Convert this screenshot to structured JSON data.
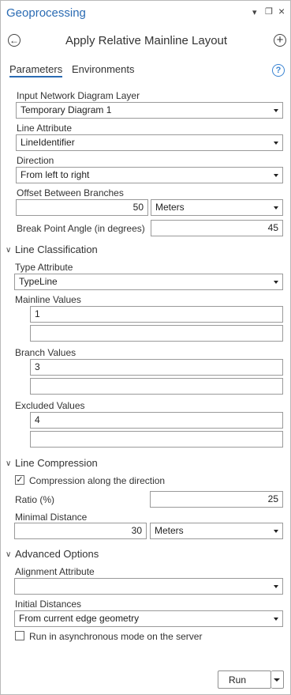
{
  "pane": {
    "title": "Geoprocessing",
    "controls": {
      "menu": "▾",
      "restore": "❐",
      "close": "×"
    }
  },
  "tool": {
    "title": "Apply Relative Mainline Layout",
    "back_icon": "arrow-left-icon",
    "add_icon": "plus-circle-icon"
  },
  "tabs": {
    "parameters": "Parameters",
    "environments": "Environments",
    "help": "?"
  },
  "params": {
    "input_layer": {
      "label": "Input Network Diagram Layer",
      "value": "Temporary Diagram 1"
    },
    "line_attribute": {
      "label": "Line Attribute",
      "value": "LineIdentifier"
    },
    "direction": {
      "label": "Direction",
      "value": "From left to right"
    },
    "offset": {
      "label": "Offset Between Branches",
      "value": "50",
      "unit": "Meters"
    },
    "break_angle": {
      "label": "Break Point Angle (in degrees)",
      "value": "45"
    }
  },
  "line_classification": {
    "title": "Line Classification",
    "type_attribute": {
      "label": "Type Attribute",
      "value": "TypeLine"
    },
    "mainline": {
      "label": "Mainline Values",
      "values": [
        "1",
        ""
      ]
    },
    "branch": {
      "label": "Branch Values",
      "values": [
        "3",
        ""
      ]
    },
    "excluded": {
      "label": "Excluded Values",
      "values": [
        "4",
        ""
      ]
    }
  },
  "line_compression": {
    "title": "Line Compression",
    "compression": {
      "label": "Compression along the direction",
      "checked": true
    },
    "ratio": {
      "label": "Ratio (%)",
      "value": "25"
    },
    "minimal_distance": {
      "label": "Minimal Distance",
      "value": "30",
      "unit": "Meters"
    }
  },
  "advanced": {
    "title": "Advanced Options",
    "alignment_attribute": {
      "label": "Alignment Attribute",
      "value": ""
    },
    "initial_distances": {
      "label": "Initial Distances",
      "value": "From current edge geometry"
    },
    "async": {
      "label": "Run in asynchronous mode on the server",
      "checked": false
    }
  },
  "run": {
    "label": "Run"
  },
  "colors": {
    "accent": "#2a6bb3",
    "run_icon": "#3a8fdc"
  }
}
